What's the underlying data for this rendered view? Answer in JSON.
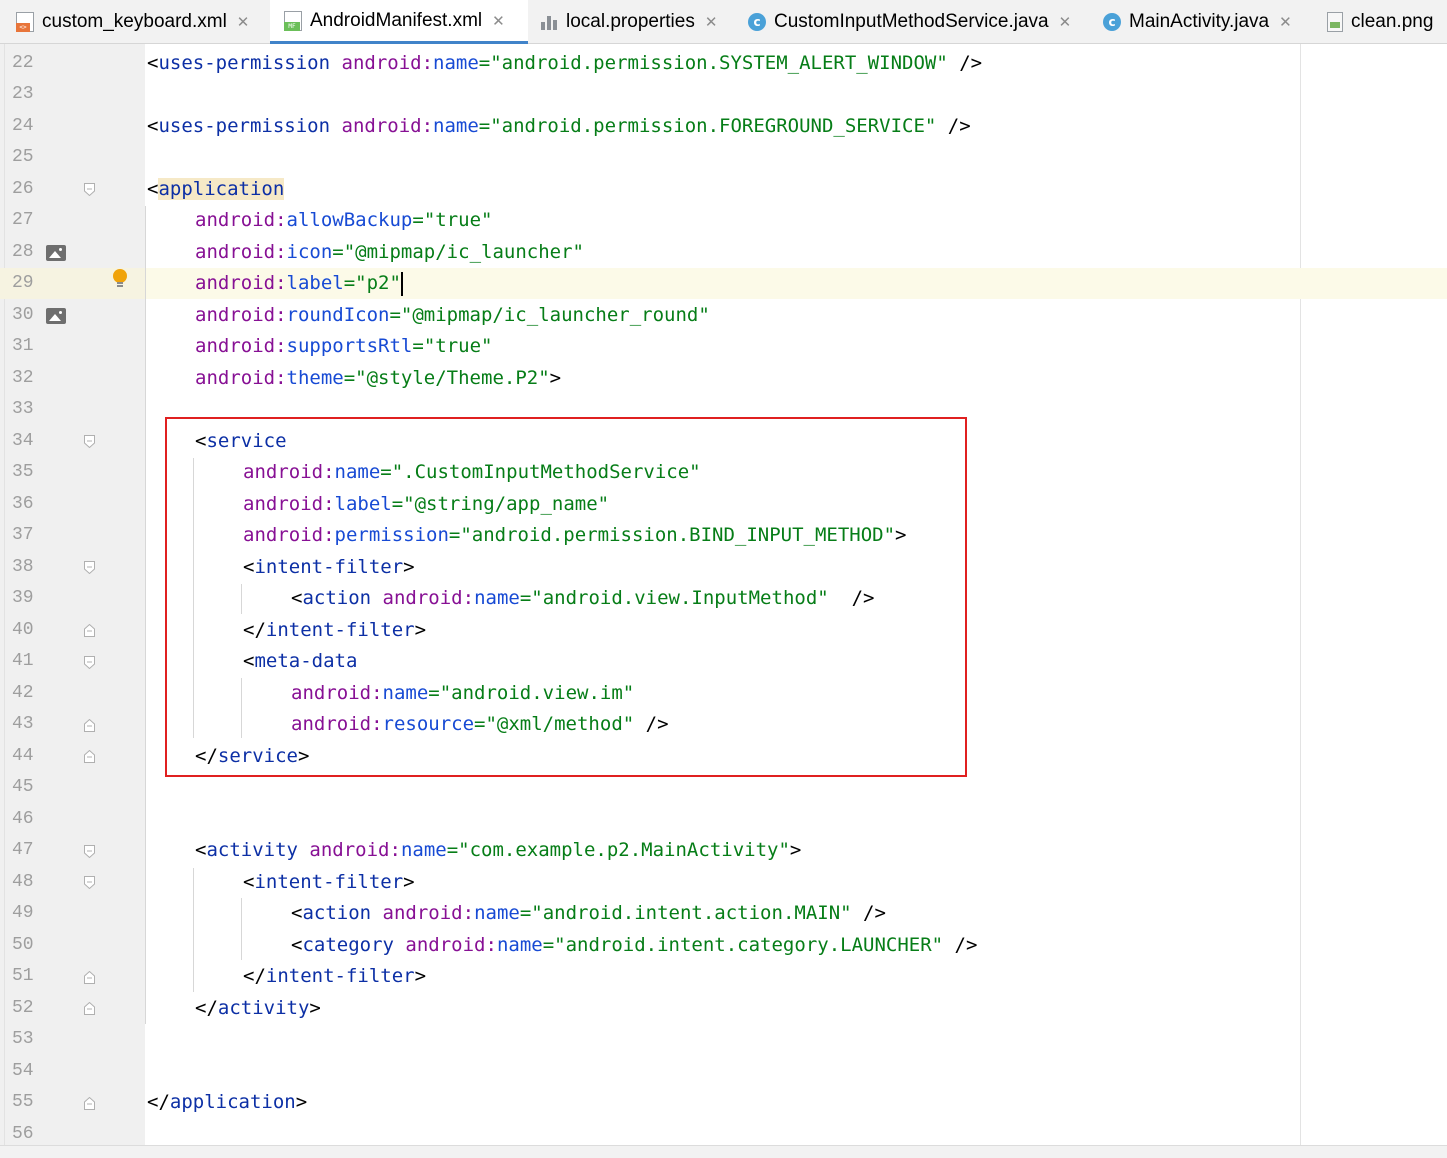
{
  "tabs": [
    {
      "label": "custom_keyboard.xml",
      "icon": "xml-file-icon",
      "closable": true,
      "active": false
    },
    {
      "label": "AndroidManifest.xml",
      "icon": "manifest-file-icon",
      "closable": true,
      "active": true
    },
    {
      "label": "local.properties",
      "icon": "properties-file-icon",
      "closable": true,
      "active": false
    },
    {
      "label": "CustomInputMethodService.java",
      "icon": "java-class-icon",
      "closable": true,
      "active": false
    },
    {
      "label": "MainActivity.java",
      "icon": "java-class-icon",
      "closable": true,
      "active": false
    },
    {
      "label": "clean.png",
      "icon": "image-file-icon",
      "closable": false,
      "active": false
    }
  ],
  "tab_close_glyph": "✕",
  "line_numbers": [
    "22",
    "23",
    "24",
    "25",
    "26",
    "27",
    "28",
    "29",
    "30",
    "31",
    "32",
    "33",
    "34",
    "35",
    "36",
    "37",
    "38",
    "39",
    "40",
    "41",
    "42",
    "43",
    "44",
    "45",
    "46",
    "47",
    "48",
    "49",
    "50",
    "51",
    "52",
    "53",
    "54",
    "55",
    "56"
  ],
  "current_line": "29",
  "colors": {
    "tag": "#0c2fa5",
    "namespace": "#871094",
    "attribute": "#174ad4",
    "value": "#067d17",
    "highlight_box": "#e02020",
    "current_line_bg": "#fcfae8"
  },
  "code": {
    "l22": {
      "open": "<",
      "tag": "uses-permission",
      "ns": "android:",
      "attr": "name",
      "eq": "=",
      "val": "\"android.permission.SYSTEM_ALERT_WINDOW\"",
      "close": " />"
    },
    "l24": {
      "open": "<",
      "tag": "uses-permission",
      "ns": "android:",
      "attr": "name",
      "eq": "=",
      "val": "\"android.permission.FOREGROUND_SERVICE\"",
      "close": " />"
    },
    "l26": {
      "open": "<",
      "tag": "application"
    },
    "l27": {
      "ns": "android:",
      "attr": "allowBackup",
      "eq": "=",
      "val": "\"true\""
    },
    "l28": {
      "ns": "android:",
      "attr": "icon",
      "eq": "=",
      "val": "\"@mipmap/ic_launcher\""
    },
    "l29": {
      "ns": "android:",
      "attr": "label",
      "eq": "=",
      "val": "\"p2\""
    },
    "l30": {
      "ns": "android:",
      "attr": "roundIcon",
      "eq": "=",
      "val": "\"@mipmap/ic_launcher_round\""
    },
    "l31": {
      "ns": "android:",
      "attr": "supportsRtl",
      "eq": "=",
      "val": "\"true\""
    },
    "l32": {
      "ns": "android:",
      "attr": "theme",
      "eq": "=",
      "val": "\"@style/Theme.P2\"",
      "close": ">"
    },
    "l34": {
      "open": "<",
      "tag": "service"
    },
    "l35": {
      "ns": "android:",
      "attr": "name",
      "eq": "=",
      "val": "\".CustomInputMethodService\""
    },
    "l36": {
      "ns": "android:",
      "attr": "label",
      "eq": "=",
      "val": "\"@string/app_name\""
    },
    "l37": {
      "ns": "android:",
      "attr": "permission",
      "eq": "=",
      "val": "\"android.permission.BIND_INPUT_METHOD\"",
      "close": ">"
    },
    "l38": {
      "open": "<",
      "tag": "intent-filter",
      "close": ">"
    },
    "l39": {
      "open": "<",
      "tag": "action",
      "ns": "android:",
      "attr": "name",
      "eq": "=",
      "val": "\"android.view.InputMethod\"",
      "close": "  />"
    },
    "l40": {
      "open": "</",
      "tag": "intent-filter",
      "close": ">"
    },
    "l41": {
      "open": "<",
      "tag": "meta-data"
    },
    "l42": {
      "ns": "android:",
      "attr": "name",
      "eq": "=",
      "val": "\"android.view.im\""
    },
    "l43": {
      "ns": "android:",
      "attr": "resource",
      "eq": "=",
      "val": "\"@xml/method\"",
      "close": " />"
    },
    "l44": {
      "open": "</",
      "tag": "service",
      "close": ">"
    },
    "l47": {
      "open": "<",
      "tag": "activity",
      "ns": "android:",
      "attr": "name",
      "eq": "=",
      "val": "\"com.example.p2.MainActivity\"",
      "close": ">"
    },
    "l48": {
      "open": "<",
      "tag": "intent-filter",
      "close": ">"
    },
    "l49": {
      "open": "<",
      "tag": "action",
      "ns": "android:",
      "attr": "name",
      "eq": "=",
      "val": "\"android.intent.action.MAIN\"",
      "close": " />"
    },
    "l50": {
      "open": "<",
      "tag": "category",
      "ns": "android:",
      "attr": "name",
      "eq": "=",
      "val": "\"android.intent.category.LAUNCHER\"",
      "close": " />"
    },
    "l51": {
      "open": "</",
      "tag": "intent-filter",
      "close": ">"
    },
    "l52": {
      "open": "</",
      "tag": "activity",
      "close": ">"
    },
    "l55": {
      "open": "</",
      "tag": "application",
      "close": ">"
    }
  }
}
